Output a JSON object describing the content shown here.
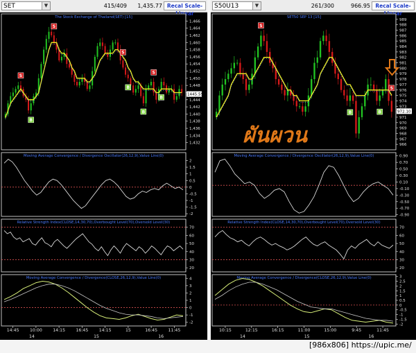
{
  "watermark": "[986x806] https://upic.me/",
  "left": {
    "symbol": "SET",
    "count": "415/409",
    "price": "1,435.77",
    "recal": "Recal Scale-Linear"
  },
  "right": {
    "symbol": "S50U13",
    "count": "261/300",
    "price": "966.95",
    "recal": "Recal Scale-Linear",
    "annotation": "ผันผวน"
  },
  "colors": {
    "up": "#22c322",
    "down": "#d51919",
    "ma": "#f0f020",
    "ma2": "#7aa0ff",
    "line": "#d8d8d8",
    "grid": "#c9c9c9",
    "ref": "#d85050",
    "title": "#4a7bff",
    "axis": "#d0d0d0",
    "annotation": "#e07818",
    "lastBox": "#ffffff"
  },
  "chart_data": [
    {
      "panel": "left-price",
      "type": "candlestick",
      "title": "The Stock Exchange of Thailand(SET) [15]",
      "ylim": [
        1430,
        1468
      ],
      "yticks": [
        "1,466",
        "1,464",
        "1,462",
        "1,460",
        "1,458",
        "1,456",
        "1,454",
        "1,452",
        "1,450",
        "1,448",
        "1,446",
        "1,444",
        "1,442",
        "1,440",
        "1,438",
        "1,436",
        "1,434",
        "1,432"
      ],
      "last": "1445.59",
      "close": [
        1440,
        1443,
        1445,
        1446,
        1447,
        1448,
        1447,
        1445,
        1444,
        1441,
        1443,
        1445,
        1446,
        1450,
        1454,
        1458,
        1461,
        1463,
        1462,
        1460,
        1458,
        1455,
        1456,
        1457,
        1454,
        1453,
        1451,
        1449,
        1448,
        1449,
        1450,
        1449,
        1447,
        1448,
        1452,
        1456,
        1459,
        1460,
        1459,
        1457,
        1456,
        1458,
        1460,
        1460,
        1458,
        1455,
        1453,
        1451,
        1450,
        1448,
        1446,
        1447,
        1448,
        1445,
        1443,
        1447,
        1448,
        1449,
        1446,
        1444,
        1447,
        1449,
        1448,
        1446,
        1447,
        1447,
        1444,
        1445,
        1447,
        1446
      ],
      "ma": [
        1439,
        1441,
        1443,
        1444,
        1445,
        1446,
        1447,
        1446,
        1445,
        1444,
        1444,
        1444,
        1445,
        1446,
        1449,
        1452,
        1455,
        1458,
        1460,
        1460,
        1460,
        1458,
        1457,
        1457,
        1456,
        1455,
        1453,
        1452,
        1450,
        1450,
        1450,
        1450,
        1449,
        1449,
        1450,
        1451,
        1453,
        1455,
        1456,
        1457,
        1457,
        1457,
        1457,
        1458,
        1458,
        1457,
        1456,
        1455,
        1453,
        1452,
        1450,
        1449,
        1449,
        1448,
        1447,
        1447,
        1447,
        1447,
        1447,
        1446,
        1446,
        1447,
        1447,
        1447,
        1447,
        1447,
        1446,
        1446,
        1446,
        1446
      ],
      "signals": [
        {
          "i": 6,
          "t": "S"
        },
        {
          "i": 10,
          "t": "B"
        },
        {
          "i": 19,
          "t": "S"
        },
        {
          "i": 46,
          "t": "S"
        },
        {
          "i": 48,
          "t": "B"
        },
        {
          "i": 54,
          "t": "B"
        },
        {
          "i": 58,
          "t": "S"
        },
        {
          "i": 61,
          "t": "B"
        }
      ],
      "xticks": [
        "14:45",
        "10:00",
        "14:15",
        "16:45",
        "14:15",
        "15",
        "16:45",
        "11:45"
      ]
    },
    {
      "panel": "left-macd-osc",
      "type": "line",
      "title": "Moving Average Convergence / Divergence Oscillator(26,12,9),Value Line(0)",
      "ylim": [
        -2.2,
        2.6
      ],
      "yticks": [
        "2",
        "1.5",
        "1",
        "0.5",
        "0",
        "-0.5",
        "-1",
        "-1.5",
        "-2"
      ],
      "reference": 0,
      "values": [
        1.8,
        2.1,
        1.9,
        1.5,
        1.0,
        0.5,
        0.1,
        -0.3,
        -0.6,
        -0.4,
        0.0,
        0.4,
        0.6,
        0.5,
        0.2,
        -0.2,
        -0.6,
        -1.0,
        -1.3,
        -1.6,
        -1.4,
        -1.0,
        -0.6,
        -0.2,
        0.2,
        0.5,
        0.6,
        0.4,
        0.1,
        -0.3,
        -0.7,
        -0.9,
        -0.8,
        -0.5,
        -0.3,
        -0.4,
        -0.2,
        -0.1,
        -0.2,
        0.1,
        0.3,
        0.1,
        -0.1,
        0.0,
        -0.2
      ]
    },
    {
      "panel": "left-rsi",
      "type": "line",
      "title": "Relative Strength Index(CLOSE,14,30,70),Overbought Level(70),Oversold Level(30)",
      "ylim": [
        15,
        80
      ],
      "yticks": [
        "70",
        "60",
        "50",
        "40",
        "30",
        "20"
      ],
      "reference": [
        70,
        30
      ],
      "values": [
        66,
        62,
        64,
        58,
        55,
        57,
        52,
        54,
        56,
        50,
        48,
        53,
        57,
        51,
        49,
        46,
        52,
        55,
        51,
        47,
        44,
        48,
        52,
        56,
        59,
        62,
        57,
        52,
        49,
        44,
        41,
        46,
        40,
        35,
        42,
        47,
        43,
        38,
        45,
        50,
        47,
        44,
        41,
        46,
        43,
        38,
        42,
        47,
        44,
        40,
        36,
        42,
        47,
        45,
        41,
        44,
        47,
        43
      ]
    },
    {
      "panel": "left-macd",
      "type": "line",
      "title": "Moving Average Convergence / Divergence(CLOSE,26,12,9),Value Line(0)",
      "ylim": [
        -2.5,
        4.5
      ],
      "yticks": [
        "4",
        "3",
        "2",
        "1",
        "0",
        "-1",
        "-2"
      ],
      "reference": 0,
      "series": [
        {
          "values": [
            1.1,
            1.5,
            2.0,
            2.6,
            3.0,
            3.4,
            3.6,
            3.5,
            3.2,
            2.7,
            2.1,
            1.4,
            0.7,
            0.0,
            -0.6,
            -1.1,
            -1.4,
            -1.5,
            -1.6,
            -1.4,
            -1.1,
            -0.9,
            -1.2,
            -1.5,
            -1.7,
            -1.6,
            -1.3,
            -1.0,
            -1.1
          ]
        },
        {
          "values": [
            0.8,
            1.1,
            1.5,
            1.9,
            2.3,
            2.7,
            3.0,
            3.2,
            3.2,
            3.0,
            2.7,
            2.3,
            1.8,
            1.3,
            0.8,
            0.3,
            -0.1,
            -0.4,
            -0.7,
            -0.9,
            -1.0,
            -1.0,
            -1.1,
            -1.2,
            -1.4,
            -1.5,
            -1.4,
            -1.3,
            -1.2
          ]
        }
      ],
      "xticks": [
        "14",
        "15",
        "16"
      ]
    },
    {
      "panel": "right-price",
      "type": "candlestick",
      "title": "SET50 SEP 13 [15]",
      "ylim": [
        965,
        990
      ],
      "yticks": [
        "989",
        "988",
        "987",
        "986",
        "985",
        "984",
        "983",
        "982",
        "981",
        "980",
        "979",
        "978",
        "977",
        "976",
        "975",
        "974",
        "973",
        "972",
        "971",
        "970",
        "969",
        "968",
        "967",
        "966"
      ],
      "last": "972.10",
      "close": [
        972,
        975,
        977,
        978,
        979,
        980,
        981,
        981,
        979,
        978,
        976,
        977,
        979,
        982,
        984,
        986,
        985,
        983,
        981,
        980,
        978,
        977,
        976,
        975,
        976,
        975,
        974,
        973,
        973,
        972,
        973,
        975,
        978,
        981,
        982,
        985,
        986,
        985,
        983,
        981,
        979,
        978,
        976,
        975,
        974,
        975,
        974,
        968,
        971,
        973,
        975,
        977,
        977,
        976,
        974,
        975,
        976,
        978,
        974,
        972
      ],
      "ma": [
        971,
        972,
        973,
        974,
        975,
        977,
        978,
        979,
        979,
        979,
        979,
        978,
        978,
        979,
        980,
        981,
        982,
        982,
        982,
        981,
        980,
        979,
        978,
        977,
        976,
        976,
        975,
        975,
        974,
        974,
        974,
        974,
        975,
        976,
        977,
        979,
        980,
        981,
        982,
        982,
        981,
        980,
        979,
        978,
        977,
        977,
        976,
        975,
        975,
        975,
        975,
        976,
        976,
        976,
        976,
        976,
        976,
        976,
        976,
        975
      ],
      "signals": [
        {
          "i": 15,
          "t": "S"
        },
        {
          "i": 45,
          "t": "B"
        },
        {
          "i": 55,
          "t": "B"
        },
        {
          "i": 59,
          "t": "S"
        }
      ],
      "xticks": [
        "10:15",
        "12:15",
        "16:15",
        "11:00",
        "15:00",
        "9:45",
        "11:45"
      ]
    },
    {
      "panel": "right-macd-osc",
      "type": "line",
      "title": "Moving Average Convergence / Divergence Oscillator(26,12,9),Value Line(0)",
      "ylim": [
        -0.95,
        1.0
      ],
      "yticks": [
        "0.90",
        "0.70",
        "0.50",
        "0.30",
        "0.10",
        "-0.10",
        "-0.30",
        "-0.50",
        "-0.70",
        "-0.90"
      ],
      "reference": 0,
      "values": [
        0.4,
        0.75,
        0.8,
        0.6,
        0.35,
        0.2,
        0.05,
        0.1,
        0.0,
        -0.25,
        -0.4,
        -0.3,
        -0.15,
        -0.1,
        -0.2,
        -0.5,
        -0.75,
        -0.85,
        -0.8,
        -0.6,
        -0.35,
        0.0,
        0.4,
        0.6,
        0.55,
        0.3,
        0.0,
        -0.3,
        -0.5,
        -0.4,
        -0.2,
        -0.05,
        0.05,
        0.1,
        0.0,
        -0.1,
        -0.3
      ]
    },
    {
      "panel": "right-rsi",
      "type": "line",
      "title": "Relative Strength Index(CLOSE,14,30,70),Overbought Level(70),Oversold Level(30)",
      "ylim": [
        15,
        80
      ],
      "yticks": [
        "70",
        "60",
        "50",
        "40",
        "30",
        "20"
      ],
      "reference": [
        70,
        30
      ],
      "values": [
        58,
        63,
        66,
        61,
        57,
        55,
        52,
        54,
        50,
        47,
        52,
        56,
        58,
        55,
        51,
        48,
        50,
        47,
        45,
        42,
        44,
        47,
        51,
        55,
        58,
        53,
        49,
        47,
        50,
        52,
        48,
        45,
        42,
        37,
        31,
        42,
        47,
        44,
        49,
        52,
        55,
        50,
        47,
        52,
        48,
        46,
        44,
        48
      ]
    },
    {
      "panel": "right-macd",
      "type": "line",
      "title": "Moving Average Convergence / Divergence(CLOSE,26,12,9),Value Line(0)",
      "ylim": [
        -2.2,
        3.2
      ],
      "yticks": [
        "3",
        "2.5",
        "2",
        "1.5",
        "1",
        "0.5",
        "0",
        "-0.5",
        "-1",
        "-1.5",
        "-2"
      ],
      "reference": 0,
      "series": [
        {
          "values": [
            1.0,
            1.6,
            2.2,
            2.6,
            2.8,
            2.7,
            2.4,
            2.0,
            1.5,
            1.0,
            0.5,
            0.0,
            -0.4,
            -0.7,
            -0.8,
            -0.6,
            -0.4,
            -0.5,
            -0.9,
            -1.3,
            -1.6,
            -1.7,
            -1.8,
            -1.7,
            -1.6,
            -1.8,
            -1.9
          ]
        },
        {
          "values": [
            0.6,
            1.0,
            1.5,
            1.9,
            2.2,
            2.4,
            2.4,
            2.2,
            1.9,
            1.6,
            1.2,
            0.8,
            0.4,
            0.1,
            -0.2,
            -0.3,
            -0.4,
            -0.4,
            -0.6,
            -0.8,
            -1.0,
            -1.2,
            -1.4,
            -1.5,
            -1.6,
            -1.6,
            -1.7
          ]
        }
      ],
      "xticks": [
        "14",
        "15",
        "16"
      ]
    }
  ]
}
